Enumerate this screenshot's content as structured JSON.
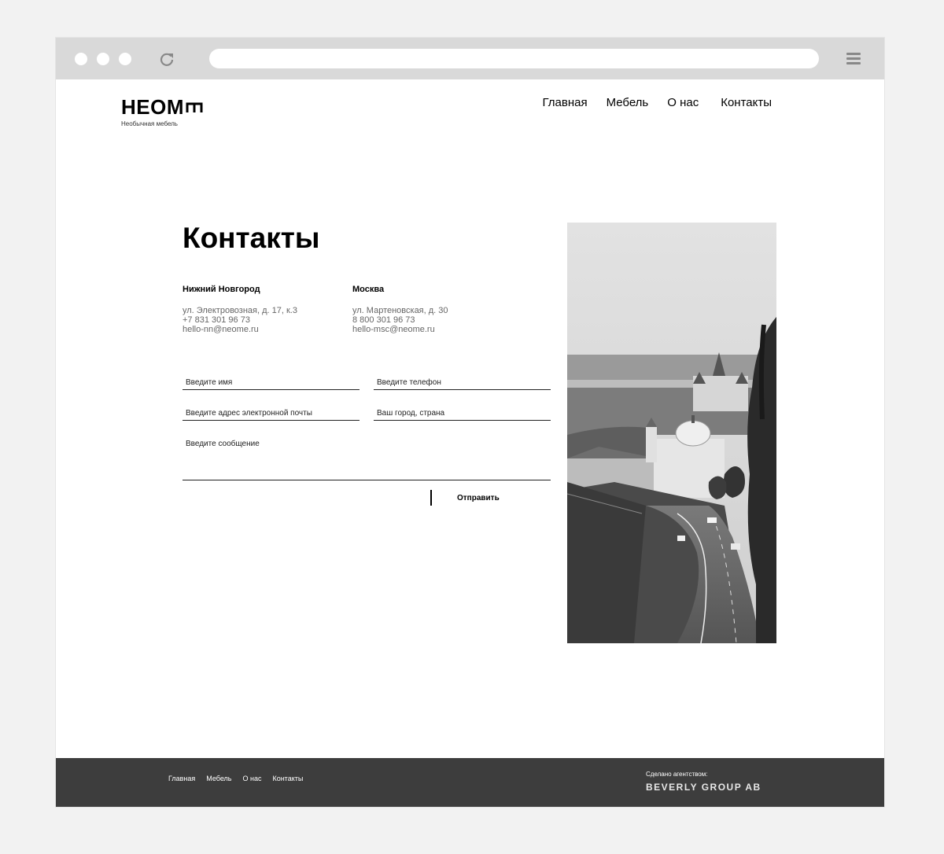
{
  "logo": {
    "text": "HEOM",
    "tagline": "Необычная мебель"
  },
  "nav": [
    "Главная",
    "Мебель",
    "О нас",
    "Контакты"
  ],
  "page_title": "Контакты",
  "cities": [
    {
      "name": "Нижний Новгород",
      "address": "ул. Электровозная, д. 17, к.3",
      "phone": "+7 831 301 96 73",
      "email": "hello-nn@neome.ru"
    },
    {
      "name": "Москва",
      "address": "ул. Мартеновская, д. 30",
      "phone": "8 800 301 96 73",
      "email": "hello-msc@neome.ru"
    }
  ],
  "form": {
    "name_placeholder": "Введите имя",
    "phone_placeholder": "Введите телефон",
    "email_placeholder": "Введите адрес электронной почты",
    "city_placeholder": "Ваш город, страна",
    "message_placeholder": "Введите сообщение",
    "submit_label": "Отправить"
  },
  "footer": {
    "nav": [
      "Главная",
      "Мебель",
      "О нас",
      "Контакты"
    ],
    "credit_label": "Сделано агентством:",
    "credit_name": "BEVERLY GROUP AB"
  }
}
